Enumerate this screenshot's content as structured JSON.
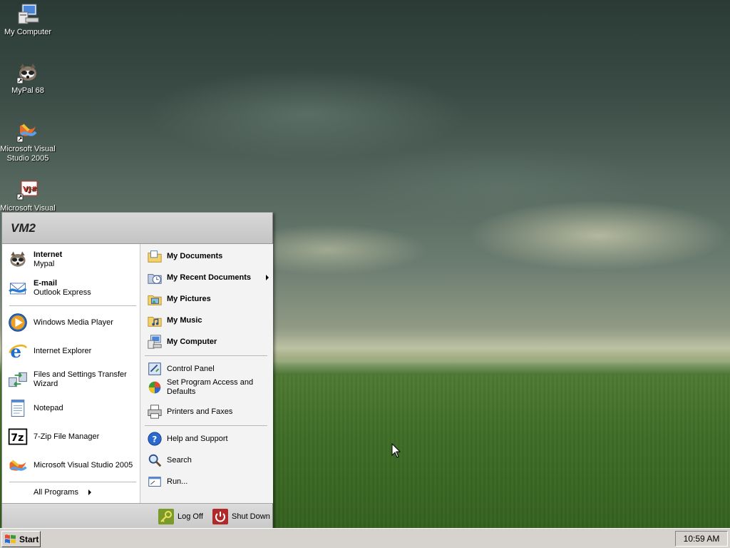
{
  "desktop": {
    "icons": [
      {
        "label": "My Computer",
        "icon": "my-computer-icon"
      },
      {
        "label": "MyPal 68",
        "icon": "mypal-icon"
      },
      {
        "label": "Microsoft Visual Studio 2005",
        "icon": "visual-studio-icon"
      },
      {
        "label": "Microsoft Visual",
        "icon": "visual-jsharp-icon"
      }
    ]
  },
  "start_menu": {
    "user_name": "VM2",
    "pinned": [
      {
        "title": "Internet",
        "subtitle": "Mypal",
        "icon": "mypal-icon"
      },
      {
        "title": "E-mail",
        "subtitle": "Outlook Express",
        "icon": "outlook-express-icon"
      }
    ],
    "recent": [
      {
        "label": "Windows Media Player",
        "icon": "windows-media-player-icon"
      },
      {
        "label": "Internet Explorer",
        "icon": "internet-explorer-icon"
      },
      {
        "label": "Files and Settings Transfer Wizard",
        "icon": "transfer-wizard-icon"
      },
      {
        "label": "Notepad",
        "icon": "notepad-icon"
      },
      {
        "label": "7-Zip File Manager",
        "icon": "7zip-icon"
      },
      {
        "label": "Microsoft Visual Studio 2005",
        "icon": "visual-studio-icon"
      }
    ],
    "all_programs": "All Programs",
    "places": [
      {
        "label": "My Documents",
        "icon": "my-documents-icon"
      },
      {
        "label": "My Recent Documents",
        "icon": "my-recent-documents-icon"
      },
      {
        "label": "My Pictures",
        "icon": "my-pictures-icon"
      },
      {
        "label": "My Music",
        "icon": "my-music-icon"
      },
      {
        "label": "My Computer",
        "icon": "my-computer-icon"
      }
    ],
    "settings": [
      {
        "label": "Control Panel",
        "icon": "control-panel-icon"
      },
      {
        "label": "Set Program Access and Defaults",
        "icon": "program-access-icon"
      },
      {
        "label": "Printers and Faxes",
        "icon": "printers-icon"
      }
    ],
    "help": [
      {
        "label": "Help and Support",
        "icon": "help-icon"
      },
      {
        "label": "Search",
        "icon": "search-icon"
      },
      {
        "label": "Run...",
        "icon": "run-icon"
      }
    ],
    "footer": {
      "log_off": "Log Off",
      "shut_down": "Shut Down"
    }
  },
  "taskbar": {
    "start_label": "Start",
    "clock": "10:59 AM"
  },
  "colors": {
    "header_bg": "#c8c8c8",
    "taskbar_bg": "#d6d3ce",
    "right_pane_bg": "#f3f3f3"
  }
}
